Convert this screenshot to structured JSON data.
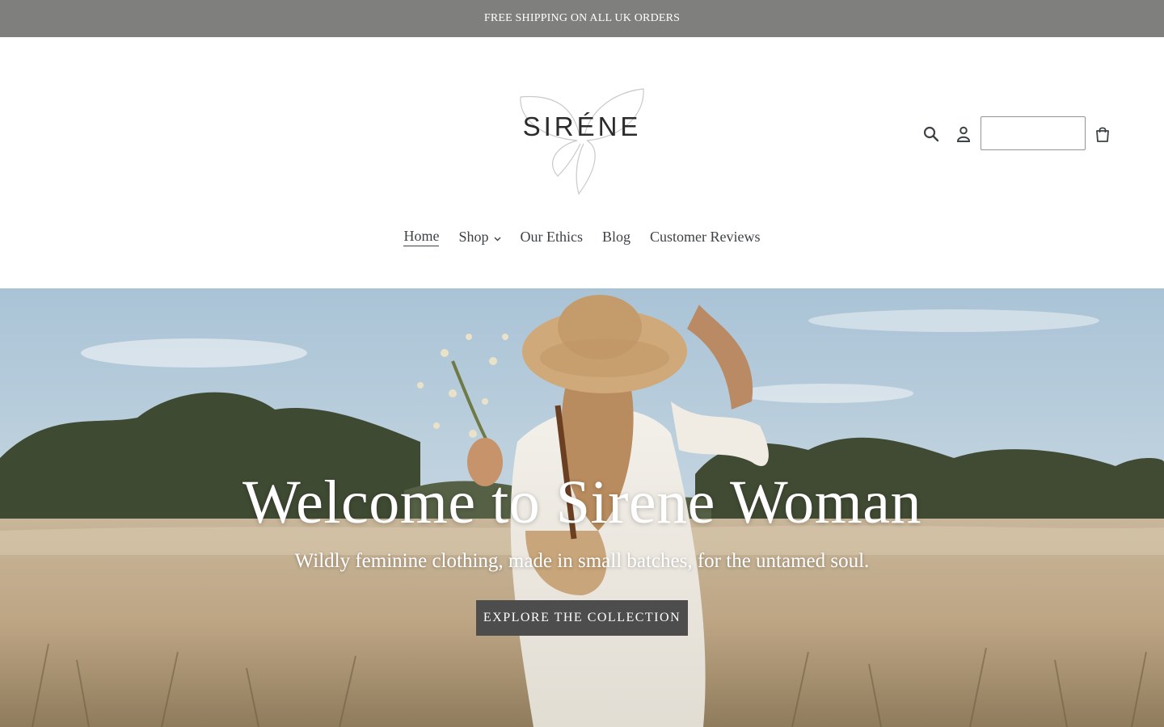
{
  "announcement": {
    "text": "FREE SHIPPING ON ALL UK ORDERS",
    "bg_color": "#7f7f7d"
  },
  "header": {
    "logo_text": "SIRÉNE",
    "icons": [
      "search-icon",
      "account-icon",
      "cart-icon"
    ],
    "input": {
      "value": "",
      "placeholder": ""
    }
  },
  "nav": {
    "items": [
      {
        "label": "Home",
        "active": true
      },
      {
        "label": "Shop",
        "has_dropdown": true
      },
      {
        "label": "Our Ethics"
      },
      {
        "label": "Blog"
      },
      {
        "label": "Customer Reviews"
      }
    ]
  },
  "hero": {
    "title": "Welcome to Sirene Woman",
    "subtitle": "Wildly feminine clothing, made in small batches, for the untamed soul.",
    "button_label": "EXPLORE THE COLLECTION",
    "button_color": "#4d4d4d"
  }
}
